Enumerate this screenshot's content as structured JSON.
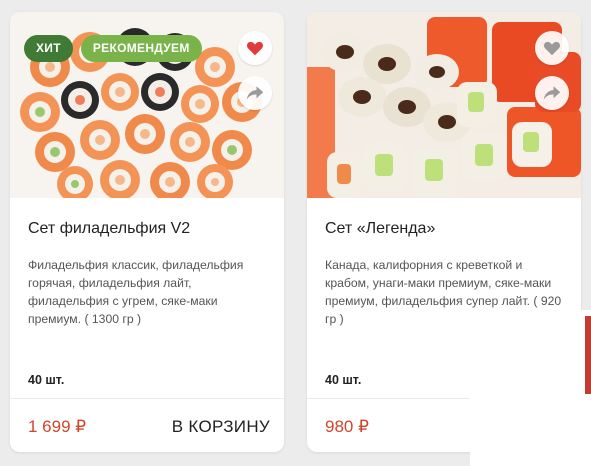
{
  "colors": {
    "price": "#d2452b",
    "badge_hit": "#3f7b35",
    "badge_rec": "#79b34a",
    "heart": "#e23b3b",
    "heart_inactive": "#9a9a9a"
  },
  "products": [
    {
      "badges": [
        "ХИТ",
        "РЕКОМЕНДУЕМ"
      ],
      "favorite_icon": "heart-icon",
      "favorite_active": true,
      "share_icon": "share-arrow-icon",
      "title": "Сет филадельфия V2",
      "description": "Филадельфия классик, филадельфия горячая, филадельфия лайт, филадельфия с угрем, сяке-маки премиум. ( 1300 гр )",
      "quantity": "40 шт.",
      "price": "1 699 ₽",
      "cart_label": "В КОРЗИНУ"
    },
    {
      "badges": [],
      "favorite_icon": "heart-icon",
      "favorite_active": false,
      "share_icon": "share-arrow-icon",
      "title": "Сет «Легенда»",
      "description": "Канада, калифорния с креветкой и крабом, унаги-маки премиум, сяке-маки премиум, филадельфия супер лайт. ( 920 гр )",
      "quantity": "40 шт.",
      "price": "980 ₽"
    }
  ]
}
